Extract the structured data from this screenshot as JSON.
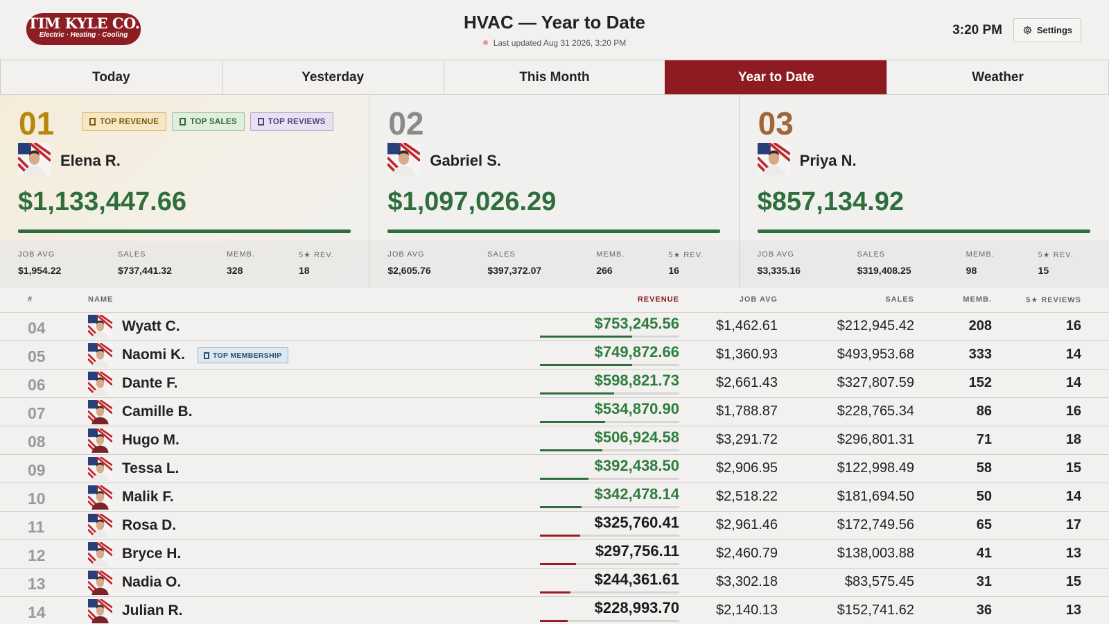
{
  "header": {
    "logo_main": "TIM KYLE CO.",
    "logo_sub": "Electric · Heating · Cooling",
    "title": "HVAC — Year to Date",
    "last_updated": "Last updated Aug 31 2026, 3:20 PM",
    "clock": "3:20 PM",
    "settings_label": "Settings"
  },
  "tabs": [
    {
      "label": "Today",
      "active": false
    },
    {
      "label": "Yesterday",
      "active": false
    },
    {
      "label": "This Month",
      "active": false
    },
    {
      "label": "Year to Date",
      "active": true
    },
    {
      "label": "Weather",
      "active": false
    }
  ],
  "stat_labels": [
    "JOB AVG",
    "SALES",
    "MEMB.",
    "5★ REV."
  ],
  "podium": [
    {
      "rank": "01",
      "rank_color": "#b8860b",
      "name": "Elena R.",
      "revenue": "$1,133,447.66",
      "badges": [
        {
          "label": "TOP REVENUE",
          "type": "rev"
        },
        {
          "label": "TOP SALES",
          "type": "sales"
        },
        {
          "label": "TOP REVIEWS",
          "type": "reviews"
        }
      ],
      "job_avg": "$1,954.22",
      "sales": "$737,441.32",
      "memb": "328",
      "reviews": "18",
      "shirt": "light"
    },
    {
      "rank": "02",
      "rank_color": "#8a8a8a",
      "name": "Gabriel S.",
      "revenue": "$1,097,026.29",
      "badges": [],
      "job_avg": "$2,605.76",
      "sales": "$397,372.07",
      "memb": "266",
      "reviews": "16",
      "shirt": "light"
    },
    {
      "rank": "03",
      "rank_color": "#a0653a",
      "name": "Priya N.",
      "revenue": "$857,134.92",
      "badges": [],
      "job_avg": "$3,335.16",
      "sales": "$319,408.25",
      "memb": "98",
      "reviews": "15",
      "shirt": "light"
    }
  ],
  "table": {
    "headers": {
      "num": "#",
      "name": "NAME",
      "revenue": "REVENUE",
      "job_avg": "JOB AVG",
      "sales": "SALES",
      "memb": "MEMB.",
      "reviews": "5★ REVIEWS"
    },
    "rows": [
      {
        "num": "04",
        "name": "Wyatt C.",
        "revenue": "$753,245.56",
        "progress": 0.66,
        "status": "green",
        "job_avg": "$1,462.61",
        "sales": "$212,945.42",
        "memb": "208",
        "reviews": "16",
        "shirt": "light",
        "badge": ""
      },
      {
        "num": "05",
        "name": "Naomi K.",
        "revenue": "$749,872.66",
        "progress": 0.66,
        "status": "green",
        "job_avg": "$1,360.93",
        "sales": "$493,953.68",
        "memb": "333",
        "reviews": "14",
        "shirt": "light",
        "badge": "TOP MEMBERSHIP"
      },
      {
        "num": "06",
        "name": "Dante F.",
        "revenue": "$598,821.73",
        "progress": 0.53,
        "status": "green",
        "job_avg": "$2,661.43",
        "sales": "$327,807.59",
        "memb": "152",
        "reviews": "14",
        "shirt": "light",
        "badge": ""
      },
      {
        "num": "07",
        "name": "Camille B.",
        "revenue": "$534,870.90",
        "progress": 0.47,
        "status": "green",
        "job_avg": "$1,788.87",
        "sales": "$228,765.34",
        "memb": "86",
        "reviews": "16",
        "shirt": "red",
        "badge": ""
      },
      {
        "num": "08",
        "name": "Hugo M.",
        "revenue": "$506,924.58",
        "progress": 0.45,
        "status": "green",
        "job_avg": "$3,291.72",
        "sales": "$296,801.31",
        "memb": "71",
        "reviews": "18",
        "shirt": "red",
        "badge": ""
      },
      {
        "num": "09",
        "name": "Tessa L.",
        "revenue": "$392,438.50",
        "progress": 0.35,
        "status": "green",
        "job_avg": "$2,906.95",
        "sales": "$122,998.49",
        "memb": "58",
        "reviews": "15",
        "shirt": "light",
        "badge": ""
      },
      {
        "num": "10",
        "name": "Malik F.",
        "revenue": "$342,478.14",
        "progress": 0.3,
        "status": "green",
        "job_avg": "$2,518.22",
        "sales": "$181,694.50",
        "memb": "50",
        "reviews": "14",
        "shirt": "red",
        "badge": ""
      },
      {
        "num": "11",
        "name": "Rosa D.",
        "revenue": "$325,760.41",
        "progress": 0.29,
        "status": "red",
        "job_avg": "$2,961.46",
        "sales": "$172,749.56",
        "memb": "65",
        "reviews": "17",
        "shirt": "light",
        "badge": ""
      },
      {
        "num": "12",
        "name": "Bryce H.",
        "revenue": "$297,756.11",
        "progress": 0.26,
        "status": "red",
        "job_avg": "$2,460.79",
        "sales": "$138,003.88",
        "memb": "41",
        "reviews": "13",
        "shirt": "light",
        "badge": ""
      },
      {
        "num": "13",
        "name": "Nadia O.",
        "revenue": "$244,361.61",
        "progress": 0.22,
        "status": "red",
        "job_avg": "$3,302.18",
        "sales": "$83,575.45",
        "memb": "31",
        "reviews": "15",
        "shirt": "red",
        "badge": ""
      },
      {
        "num": "14",
        "name": "Julian R.",
        "revenue": "$228,993.70",
        "progress": 0.2,
        "status": "red",
        "job_avg": "$2,140.13",
        "sales": "$152,741.62",
        "memb": "36",
        "reviews": "13",
        "shirt": "red",
        "badge": ""
      }
    ]
  },
  "colors": {
    "brand": "#8e1b21",
    "positive": "#2e7d3e",
    "negative": "#9b1c22"
  }
}
